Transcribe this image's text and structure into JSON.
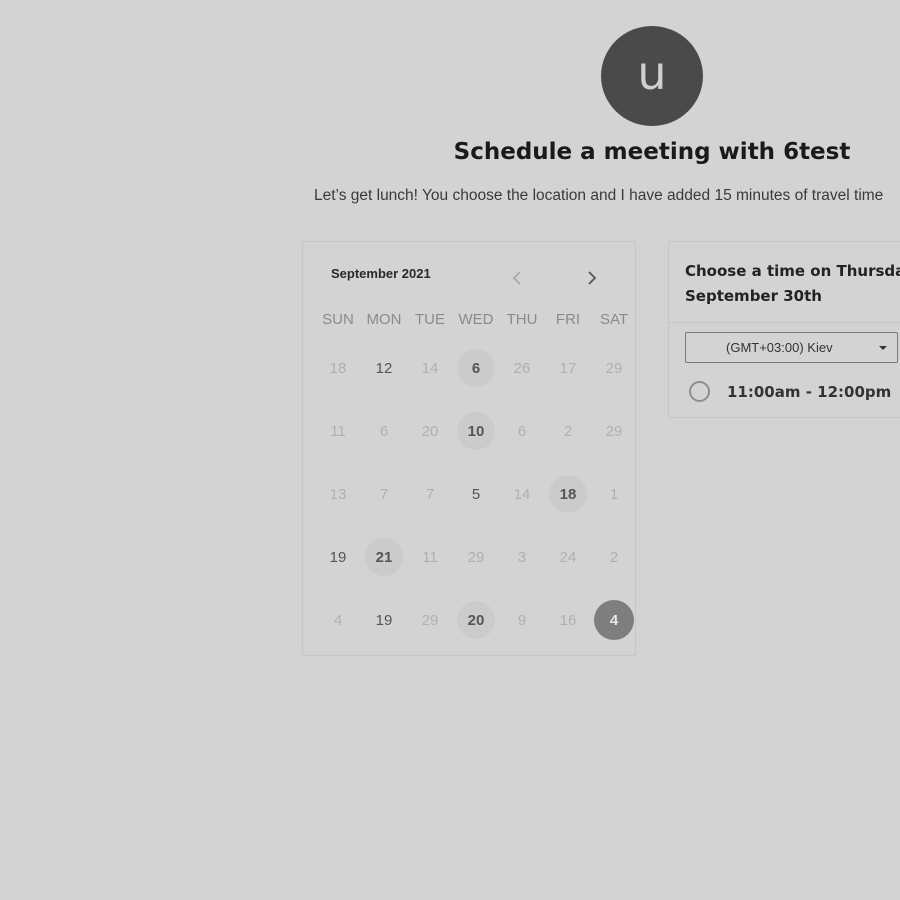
{
  "host": {
    "avatar_initial": "u",
    "title": "Schedule a meeting with 6test",
    "description": "Let’s get lunch! You choose the location and I have added 15 minutes of travel time"
  },
  "calendar": {
    "month_label": "September 2021",
    "prev_icon": "chevron-left-icon",
    "next_icon": "chevron-right-icon",
    "weekdays": [
      "SUN",
      "MON",
      "TUE",
      "WED",
      "THU",
      "FRI",
      "SAT"
    ],
    "weeks": [
      [
        "18",
        "12",
        "14",
        "6",
        "26",
        "17",
        "29"
      ],
      [
        "11",
        "6",
        "20",
        "10",
        "6",
        "2",
        "29"
      ],
      [
        "13",
        "7",
        "7",
        "5",
        "14",
        "18",
        "1"
      ],
      [
        "19",
        "21",
        "11",
        "29",
        "3",
        "24",
        "2"
      ],
      [
        "4",
        "19",
        "29",
        "20",
        "9",
        "16",
        "4"
      ]
    ],
    "states": [
      [
        "muted",
        "avail",
        "muted",
        "strong",
        "muted",
        "muted",
        "muted"
      ],
      [
        "muted",
        "muted",
        "muted",
        "strong",
        "muted",
        "muted",
        "muted"
      ],
      [
        "muted",
        "muted",
        "muted",
        "avail",
        "muted",
        "strong",
        "muted"
      ],
      [
        "avail",
        "strong",
        "muted",
        "muted",
        "muted",
        "muted",
        "muted"
      ],
      [
        "muted",
        "avail",
        "muted",
        "strong",
        "muted",
        "muted",
        "selected"
      ]
    ]
  },
  "time_panel": {
    "heading_line1": "Choose a time on Thursday",
    "heading_line2": "September 30th",
    "timezone": "(GMT+03:00) Kiev",
    "slots": [
      "11:00am - 12:00pm"
    ]
  },
  "colors": {
    "background": "#d3d3d3",
    "avatar": "#4a4a4a",
    "selected_day": "#7e7e7e",
    "highlight_day": "#cbcbcb"
  }
}
